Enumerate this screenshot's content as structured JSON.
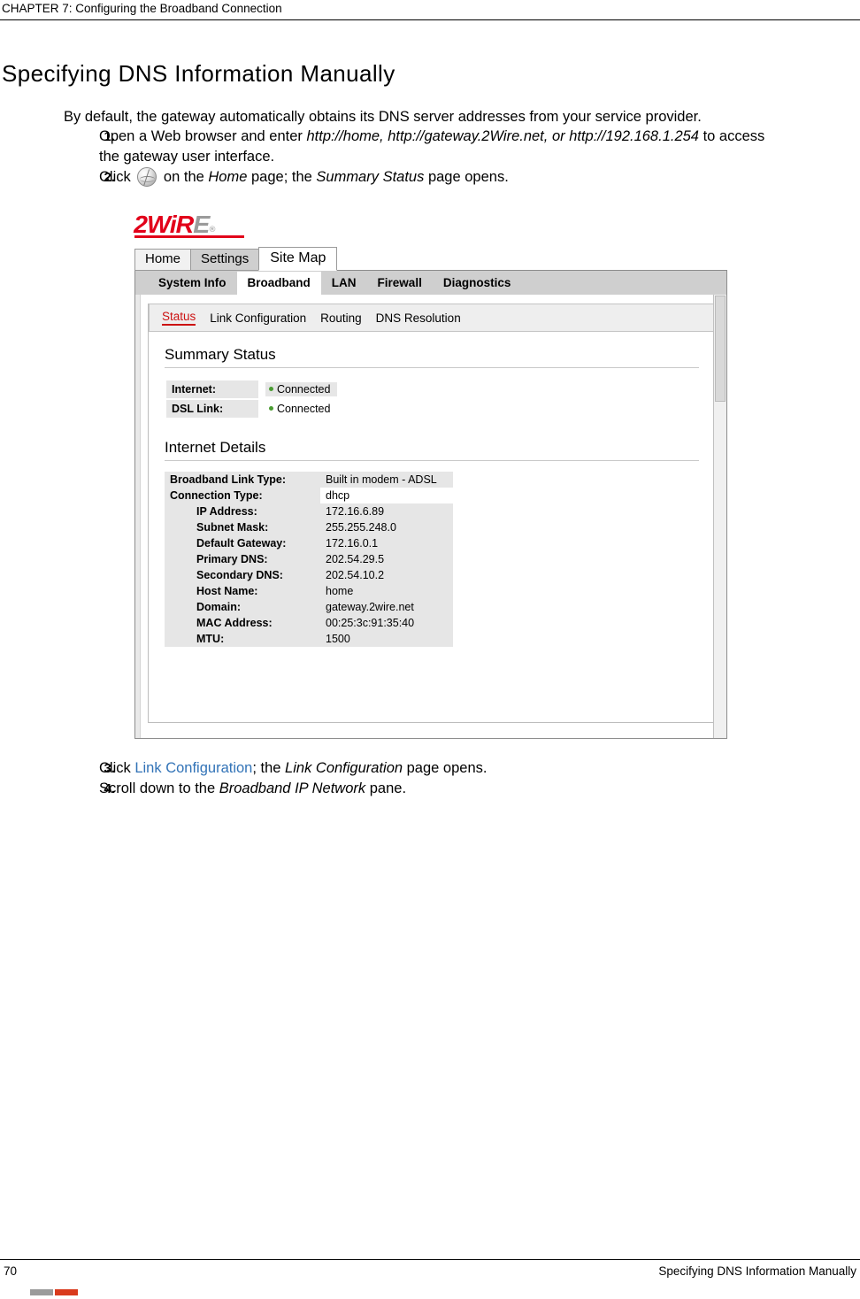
{
  "header": {
    "chapter": "CHAPTER 7: Configuring the Broadband Connection"
  },
  "section": {
    "title": "Specifying DNS Information Manually",
    "intro": "By default, the gateway automatically obtains its DNS server addresses from your service provider."
  },
  "steps": [
    {
      "num": "1.",
      "text_before": "Open a Web browser and enter ",
      "italic_1": "http://home, http://gateway.2Wire.net, or http://192.168.1.254",
      "text_after": " to access the gateway user interface."
    },
    {
      "num": "2.",
      "text_before": "Click ",
      "icon": "globe-icon",
      "mid": " on the ",
      "italic_1": "Home",
      "mid_2": " page; the ",
      "italic_2": "Summary Status",
      "text_after": " page opens."
    },
    {
      "num": "3.",
      "text_before": "Click ",
      "link": "Link Configuration",
      "mid": "; the ",
      "italic_1": "Link Configuration",
      "text_after": " page opens."
    },
    {
      "num": "4.",
      "text_before": "Scroll down to the ",
      "italic_1": "Broadband IP Network",
      "text_after": " pane."
    }
  ],
  "screenshot": {
    "brand": {
      "text_red": "2WiR",
      "text_grey": "E",
      "trademark": "®"
    },
    "top_tabs": [
      {
        "label": "Home",
        "selected": false
      },
      {
        "label": "Settings",
        "selected": true
      },
      {
        "label": "Site Map",
        "selected": false
      }
    ],
    "nav_tabs": [
      {
        "label": "System Info",
        "selected": false
      },
      {
        "label": "Broadband",
        "selected": true
      },
      {
        "label": "LAN",
        "selected": false
      },
      {
        "label": "Firewall",
        "selected": false
      },
      {
        "label": "Diagnostics",
        "selected": false
      }
    ],
    "sub_tabs": [
      {
        "label": "Status",
        "selected": true
      },
      {
        "label": "Link Configuration",
        "selected": false
      },
      {
        "label": "Routing",
        "selected": false
      },
      {
        "label": "DNS Resolution",
        "selected": false
      }
    ],
    "summary_status": {
      "title": "Summary Status",
      "rows": [
        {
          "label": "Internet:",
          "value": "Connected",
          "boxed": true
        },
        {
          "label": "DSL Link:",
          "value": "Connected",
          "boxed": false
        }
      ]
    },
    "internet_details": {
      "title": "Internet Details",
      "rows": [
        {
          "label": "Broadband Link Type:",
          "value": "Built in modem - ADSL",
          "indent": false
        },
        {
          "label": "Connection Type:",
          "value": "dhcp",
          "indent": false,
          "plain_value": true
        },
        {
          "label": "IP Address:",
          "value": "172.16.6.89",
          "indent": true
        },
        {
          "label": "Subnet Mask:",
          "value": "255.255.248.0",
          "indent": true
        },
        {
          "label": "Default Gateway:",
          "value": "172.16.0.1",
          "indent": true
        },
        {
          "label": "Primary DNS:",
          "value": "202.54.29.5",
          "indent": true
        },
        {
          "label": "Secondary DNS:",
          "value": "202.54.10.2",
          "indent": true
        },
        {
          "label": "Host Name:",
          "value": "home",
          "indent": true
        },
        {
          "label": "Domain:",
          "value": "gateway.2wire.net",
          "indent": true
        },
        {
          "label": "MAC Address:",
          "value": "00:25:3c:91:35:40",
          "indent": true
        },
        {
          "label": "MTU:",
          "value": "1500",
          "indent": true
        }
      ]
    }
  },
  "footer": {
    "page_number": "70",
    "running_title": "Specifying DNS Information Manually"
  },
  "colors": {
    "brand_red": "#e2001a",
    "link_blue": "#3273b7",
    "subtab_active": "#cc1111",
    "status_dot": "#4a9c32"
  }
}
